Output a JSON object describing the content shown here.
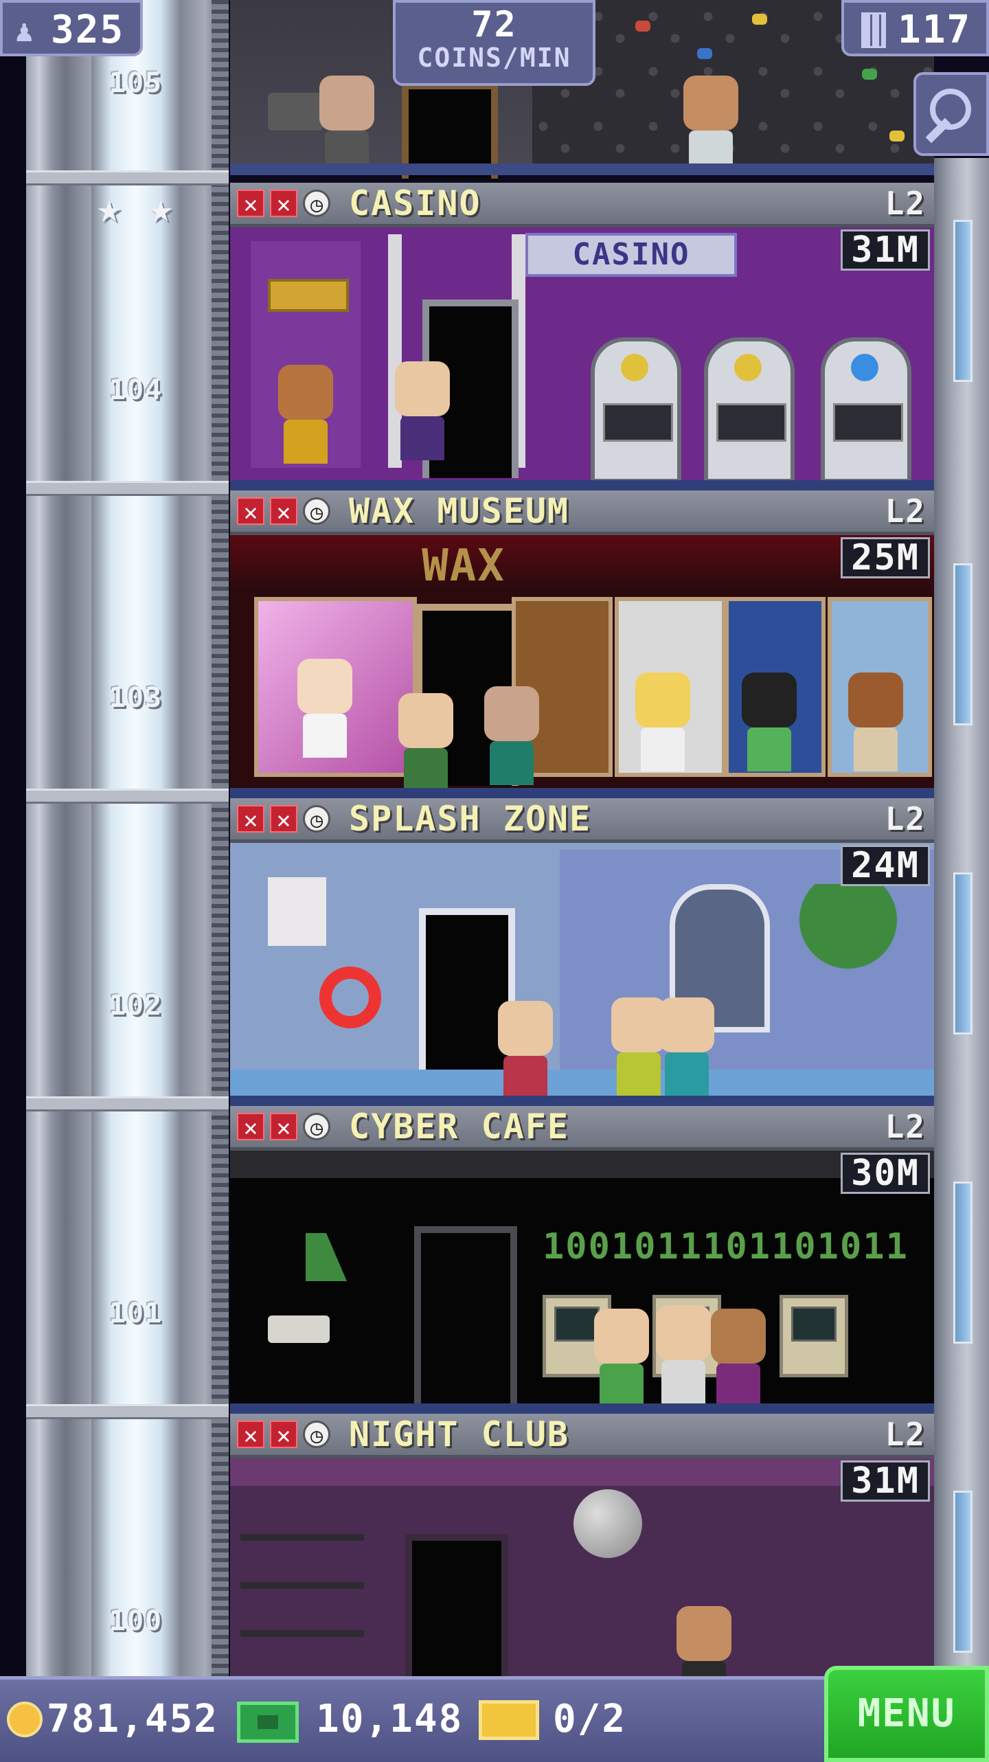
{
  "hud": {
    "population": "325",
    "coins_per_min_value": "72",
    "coins_per_min_label": "COINS/MIN",
    "floor_count": "117"
  },
  "shaft": {
    "floor_numbers": [
      "105",
      "104",
      "103",
      "102",
      "101",
      "100"
    ],
    "vip_stars": 2
  },
  "rooms": [
    {
      "name": "CASINO",
      "level": "L2",
      "income": "31M",
      "sign": "CASINO"
    },
    {
      "name": "WAX MUSEUM",
      "level": "L2",
      "income": "25M",
      "sign": "WAX"
    },
    {
      "name": "SPLASH ZONE",
      "level": "L2",
      "income": "24M"
    },
    {
      "name": "CYBER CAFE",
      "level": "L2",
      "income": "30M",
      "display_text": "1001011101101011"
    },
    {
      "name": "NIGHT CLUB",
      "level": "L2",
      "income": "31M"
    }
  ],
  "bottom_bar": {
    "coins": "781,452",
    "tower_bux": "10,148",
    "tickets": "0/2",
    "menu_label": "MENU"
  },
  "colors": {
    "room_name": "#f5f1b4",
    "hud_panel": "#5b5f8d",
    "menu_green": "#2dbd30",
    "stock_missing": "#c52231"
  },
  "icons": {
    "population": "person-icon",
    "floors": "building-icon",
    "zoom": "magnifier-icon",
    "coin": "coin-icon",
    "bux": "tower-bux-icon",
    "ticket": "vip-ticket-icon",
    "stock": "x-mark-icon",
    "timer": "clock-icon",
    "vip": "star-icon"
  }
}
